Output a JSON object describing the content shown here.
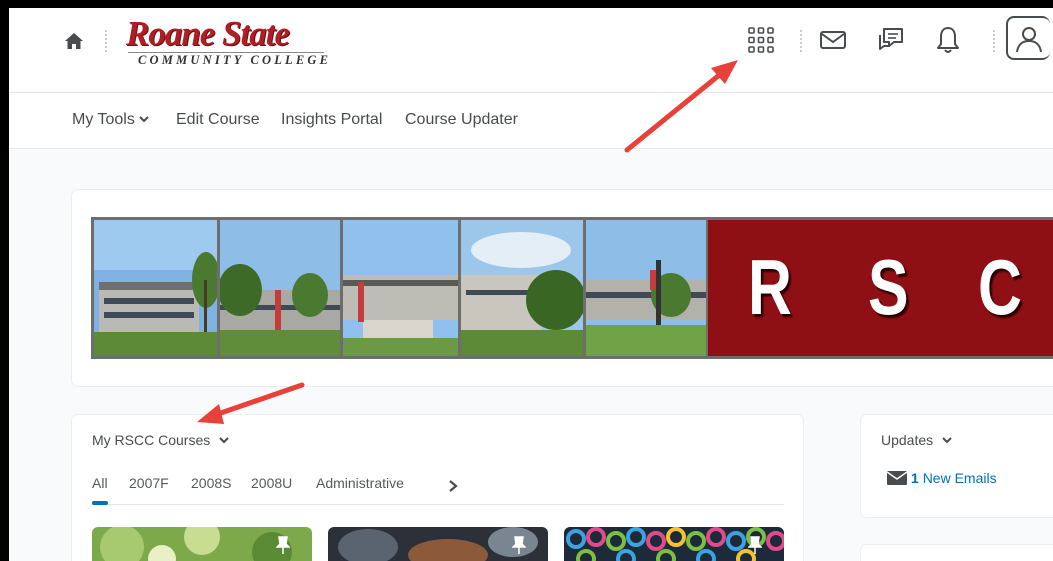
{
  "header": {
    "logo_title": "Roane State",
    "logo_subtitle": "COMMUNITY COLLEGE",
    "icons": [
      "home-icon",
      "waffle-grid-icon",
      "mail-icon",
      "chat-icon",
      "bell-icon",
      "user-avatar-icon"
    ]
  },
  "nav": {
    "items": [
      {
        "label": "My Tools",
        "has_dropdown": true
      },
      {
        "label": "Edit Course"
      },
      {
        "label": "Insights Portal"
      },
      {
        "label": "Course Updater"
      }
    ]
  },
  "banner": {
    "letters": [
      "R",
      "S",
      "C"
    ],
    "photo_count": 5
  },
  "courses": {
    "title": "My RSCC Courses",
    "tabs": [
      "All",
      "2007F",
      "2008S",
      "2008U",
      "Administrative"
    ],
    "active_tab": "All"
  },
  "updates": {
    "title": "Updates",
    "email_count": "1",
    "email_label": "New Emails"
  },
  "colors": {
    "brand_red": "#8e1015",
    "link_blue": "#006fbf",
    "arrow_red": "#e8413a"
  }
}
